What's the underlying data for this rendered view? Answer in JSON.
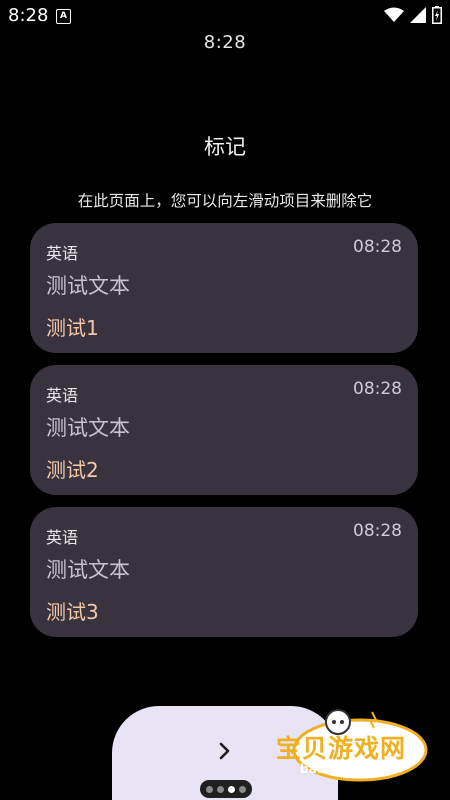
{
  "status_bar": {
    "time": "8:28",
    "notification_letter": "A"
  },
  "watch_time": "8:28",
  "page": {
    "title": "标记",
    "subtitle": "在此页面上，您可以向左滑动项目来删除它"
  },
  "cards": [
    {
      "tag": "英语",
      "time": "08:28",
      "body": "测试文本",
      "name": "测试1"
    },
    {
      "tag": "英语",
      "time": "08:28",
      "body": "测试文本",
      "name": "测试2"
    },
    {
      "tag": "英语",
      "time": "08:28",
      "body": "测试文本",
      "name": "测试3"
    }
  ],
  "pager": {
    "count": 4,
    "active_index": 2
  },
  "watermark": {
    "brand": "宝贝游戏网",
    "url": "baobeiy.com"
  },
  "colors": {
    "background": "#000000",
    "card": "#38333f",
    "accent": "#f5c9a6",
    "next_button": "#e8e4f5"
  }
}
